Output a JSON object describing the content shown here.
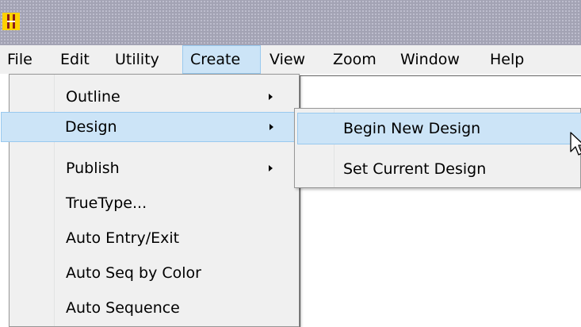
{
  "titlebar": {
    "icon": "app-logo-icon"
  },
  "menubar": {
    "items": [
      {
        "label": "File"
      },
      {
        "label": "Edit"
      },
      {
        "label": "Utility"
      },
      {
        "label": "Create"
      },
      {
        "label": "View"
      },
      {
        "label": "Zoom"
      },
      {
        "label": "Window"
      },
      {
        "label": "Help"
      }
    ]
  },
  "create_menu": {
    "items": [
      {
        "label": "Outline",
        "submenu": true
      },
      {
        "label": "Design",
        "submenu": true
      },
      {
        "label": "Publish",
        "submenu": true
      },
      {
        "label": "TrueType...",
        "submenu": false
      },
      {
        "label": "Auto Entry/Exit",
        "submenu": false
      },
      {
        "label": "Auto Seq by Color",
        "submenu": false
      },
      {
        "label": "Auto Sequence",
        "submenu": false
      }
    ]
  },
  "design_submenu": {
    "items": [
      {
        "label": "Begin New Design"
      },
      {
        "label": "Set Current Design"
      }
    ]
  },
  "colors": {
    "highlight": "#cce4f7",
    "highlight_border": "#99c9ef",
    "menu_bg": "#f0f0f0",
    "titlebar": "#a3a3b4",
    "icon_yellow": "#ffd200"
  },
  "cursor": "arrow-cursor-icon"
}
